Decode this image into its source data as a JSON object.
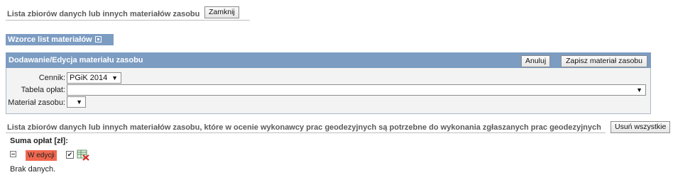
{
  "header": {
    "title": "Lista zbiorów danych lub innych materiałów zasobu",
    "close_label": "Zamknij"
  },
  "patterns": {
    "label": "Wzorce list materiałów",
    "icon": "expand-plus-icon"
  },
  "editor": {
    "title": "Dodawanie/Edycja materiału zasobu",
    "cancel_label": "Anuluj",
    "save_label": "Zapisz materiał zasobu",
    "fields": {
      "cennik_label": "Cennik:",
      "cennik_value": "PGiK 2014",
      "tabela_label": "Tabela opłat:",
      "tabela_value": "",
      "material_label": "Materiał zasobu:",
      "material_value": ""
    }
  },
  "list": {
    "title": "Lista zbiorów danych lub innych materiałów zasobu, które w ocenie wykonawcy prac geodezyjnych są potrzebne do wykonania zgłaszanych prac geodezyjnych",
    "remove_all_label": "Usuń wszystkie",
    "sum_label": "Suma opłat [zł]:",
    "status_badge": "W edycji",
    "status_color": "#f1684f",
    "checkbox_checked": true,
    "empty_text": "Brak danych."
  },
  "colors": {
    "bar": "#7c9cc2",
    "panel_bg": "#f3f3f3"
  }
}
